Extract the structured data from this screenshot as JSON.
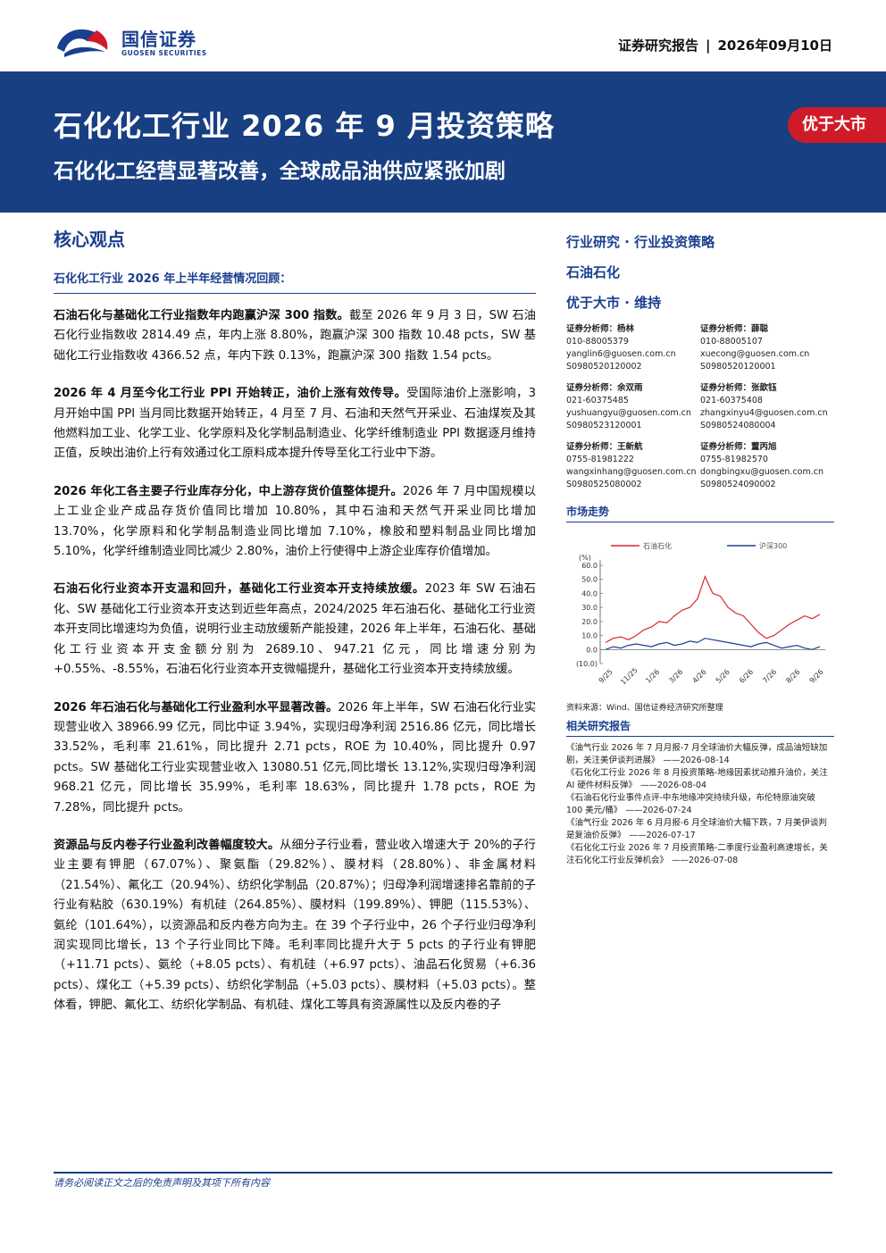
{
  "header": {
    "logo_cn": "国信证券",
    "logo_en": "GUOSEN SECURITIES",
    "report_type": "证券研究报告",
    "separator": "|",
    "date": "2026年09月10日"
  },
  "banner": {
    "title": "石化化工行业 2026 年 9 月投资策略",
    "subtitle": "石化化工经营显著改善，全球成品油供应紧张加剧",
    "rating": "优于大市"
  },
  "main": {
    "section_title": "核心观点",
    "review_title": "石化化工行业 2026 年上半年经营情况回顾：",
    "paragraphs": [
      {
        "lead": "石油石化与基础化工行业指数年内跑赢沪深 300 指数。",
        "text": "截至 2026 年 9 月 3 日，SW 石油石化行业指数收 2814.49 点，年内上涨 8.80%，跑赢沪深 300 指数 10.48 pcts，SW 基础化工行业指数收 4366.52 点，年内下跌 0.13%，跑赢沪深 300 指数 1.54 pcts。"
      },
      {
        "lead": "2026 年 4 月至今化工行业 PPI 开始转正，油价上涨有效传导。",
        "text": "受国际油价上涨影响，3 月开始中国 PPI 当月同比数据开始转正，4 月至 7 月、石油和天然气开采业、石油煤炭及其他燃料加工业、化学工业、化学原料及化学制品制造业、化学纤维制造业 PPI 数据逐月维持正值，反映出油价上行有效通过化工原料成本提升传导至化工行业中下游。"
      },
      {
        "lead": "2026 年化工各主要子行业库存分化，中上游存货价值整体提升。",
        "text": "2026 年 7 月中国规模以上工业企业产成品存货价值同比增加 10.80%，其中石油和天然气开采业同比增加 13.70%，化学原料和化学制品制造业同比增加 7.10%，橡胶和塑料制品业同比增加 5.10%，化学纤维制造业同比减少 2.80%，油价上行使得中上游企业库存价值增加。"
      },
      {
        "lead": "石油石化行业资本开支温和回升，基础化工行业资本开支持续放缓。",
        "text": "2023 年 SW 石油石化、SW 基础化工行业资本开支达到近些年高点，2024/2025 年石油石化、基础化工行业资本开支同比增速均为负值，说明行业主动放缓新产能投建，2026 年上半年，石油石化、基础化工行业资本开支金额分别为 2689.10、947.21 亿元，同比增速分别为+0.55%、-8.55%，石油石化行业资本开支微幅提升，基础化工行业资本开支持续放缓。"
      },
      {
        "lead": "2026 年石油石化与基础化工行业盈利水平显著改善。",
        "text": "2026 年上半年，SW 石油石化行业实现营业收入 38966.99 亿元，同比中证 3.94%，实现归母净利润 2516.86 亿元，同比增长 33.52%，毛利率 21.61%，同比提升 2.71 pcts，ROE 为 10.40%，同比提升 0.97 pcts。SW 基础化工行业实现营业收入 13080.51 亿元,同比增长 13.12%,实现归母净利润 968.21 亿元，同比增长 35.99%，毛利率 18.63%，同比提升 1.78 pcts，ROE 为 7.28%，同比提升 pcts。"
      },
      {
        "lead": "资源品与反内卷子行业盈利改善幅度较大。",
        "text": "从细分子行业看，营业收入增速大于 20%的子行业主要有钾肥（67.07%）、聚氨酯（29.82%）、膜材料（28.80%）、非金属材料（21.54%）、氟化工（20.94%）、纺织化学制品（20.87%）；归母净利润增速排名靠前的子行业有粘胶（630.19%）有机硅（264.85%）、膜材料（199.89%）、钾肥（115.53%）、氨纶（101.64%），以资源品和反内卷方向为主。在 39 个子行业中，26 个子行业归母净利润实现同比增长，13 个子行业同比下降。毛利率同比提升大于 5 pcts 的子行业有钾肥（+11.71 pcts）、氨纶（+8.05 pcts）、有机硅（+6.97 pcts）、油品石化贸易（+6.36 pcts）、煤化工（+5.39 pcts）、纺织化学制品（+5.03 pcts）、膜材料（+5.03 pcts）。整体看，钾肥、氟化工、纺织化学制品、有机硅、煤化工等具有资源属性以及反内卷的子"
      }
    ]
  },
  "sidebar": {
    "category": "行业研究 · 行业投资策略",
    "industry": "石油石化",
    "rating_line": "优于大市 · 维持",
    "analysts": [
      {
        "title": "证券分析师：",
        "name": "杨林",
        "phone": "010-88005379",
        "email": "yanglin6@guosen.com.cn",
        "cert": "S0980520120002"
      },
      {
        "title": "证券分析师：",
        "name": "薛聪",
        "phone": "010-88005107",
        "email": "xuecong@guosen.com.cn",
        "cert": "S0980520120001"
      },
      {
        "title": "证券分析师：",
        "name": "余双雨",
        "phone": "021-60375485",
        "email": "yushuangyu@guosen.com.cn",
        "cert": "S0980523120001"
      },
      {
        "title": "证券分析师：",
        "name": "张歆钰",
        "phone": "021-60375408",
        "email": "zhangxinyu4@guosen.com.cn",
        "cert": "S0980524080004"
      },
      {
        "title": "证券分析师：",
        "name": "王新航",
        "phone": "0755-81981222",
        "email": "wangxinhang@guosen.com.cn",
        "cert": "S0980525080002"
      },
      {
        "title": "证券分析师：",
        "name": "董丙旭",
        "phone": "0755-81982570",
        "email": "dongbingxu@guosen.com.cn",
        "cert": "S0980524090002"
      }
    ],
    "market_trend_title": "市场走势",
    "source_note": "资料来源：Wind、国信证券经济研究所整理",
    "related_title": "相关研究报告",
    "related": [
      {
        "text": "《油气行业 2026 年 7 月月报-7 月全球油价大幅反弹，成品油短缺加剧，关注美伊谈判进展》",
        "date": "——2026-08-14"
      },
      {
        "text": "《石化化工行业 2026 年 8 月投资策略-地缘因素扰动推升油价，关注 AI 硬件材料反弹》",
        "date": "——2026-08-04"
      },
      {
        "text": "《石油石化行业事件点评-中东地缘冲突持续升级，布伦特原油突破 100 美元/桶》",
        "date": "——2026-07-24"
      },
      {
        "text": "《油气行业 2026 年 6 月月报-6 月全球油价大幅下跌，7 月美伊谈判是复油价反弹》",
        "date": "——2026-07-17"
      },
      {
        "text": "《石化化工行业 2026 年 7 月投资策略-二季度行业盈利高速增长，关注石化化工行业反弹机会》",
        "date": "——2026-07-08"
      }
    ]
  },
  "chart_data": {
    "type": "line",
    "title": "",
    "unit_label": "(%)",
    "y_ticks": [
      "60.0",
      "50.0",
      "40.0",
      "30.0",
      "20.0",
      "10.0",
      "0.0",
      "(10.0)"
    ],
    "ylim": [
      -10,
      60
    ],
    "x_ticks": [
      "9/25",
      "11/25",
      "1/26",
      "3/26",
      "4/26",
      "5/26",
      "6/26",
      "7/26",
      "8/26",
      "9/26"
    ],
    "series": [
      {
        "name": "石油石化",
        "color": "#d9262c",
        "values": [
          5,
          8,
          9,
          7,
          10,
          14,
          16,
          20,
          19,
          24,
          28,
          30,
          36,
          52,
          40,
          38,
          30,
          26,
          24,
          18,
          12,
          8,
          10,
          14,
          18,
          21,
          24,
          22,
          25
        ]
      },
      {
        "name": "沪深300",
        "color": "#1b3f8f",
        "values": [
          0,
          2,
          1,
          3,
          4,
          3,
          2,
          4,
          5,
          3,
          4,
          6,
          5,
          8,
          7,
          6,
          5,
          4,
          3,
          2,
          4,
          5,
          3,
          1,
          2,
          3,
          1,
          0,
          2
        ]
      }
    ]
  },
  "footer": {
    "disclaimer": "请务必阅读正文之后的免责声明及其项下所有内容"
  }
}
